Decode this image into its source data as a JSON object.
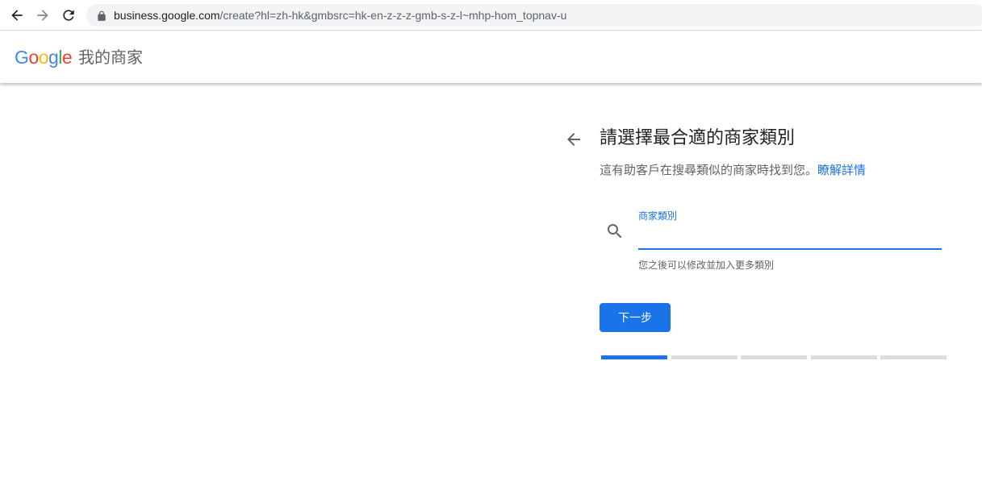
{
  "browser": {
    "url_host": "business.google.com",
    "url_path": "/create?hl=zh-hk&gmbsrc=hk-en-z-z-z-gmb-s-z-l~mhp-hom_topnav-u"
  },
  "header": {
    "logo_letters": [
      "G",
      "o",
      "o",
      "g",
      "l",
      "e"
    ],
    "logo_colors": [
      "#4285F4",
      "#EA4335",
      "#FBBC05",
      "#4285F4",
      "#34A853",
      "#EA4335"
    ],
    "app_name": "我的商家"
  },
  "main": {
    "title": "請選擇最合適的商家類別",
    "subtitle": "這有助客戶在搜尋類似的商家時找到您。",
    "learn_more": "瞭解詳情",
    "field_label": "商家類別",
    "field_value": "",
    "helper": "您之後可以修改並加入更多類別",
    "next_button": "下一步"
  },
  "progress": {
    "total_steps": 5,
    "current_step": 1
  },
  "colors": {
    "accent": "#1a73e8",
    "text_primary": "#202124",
    "text_secondary": "#5f6368",
    "track": "#dadce0"
  }
}
